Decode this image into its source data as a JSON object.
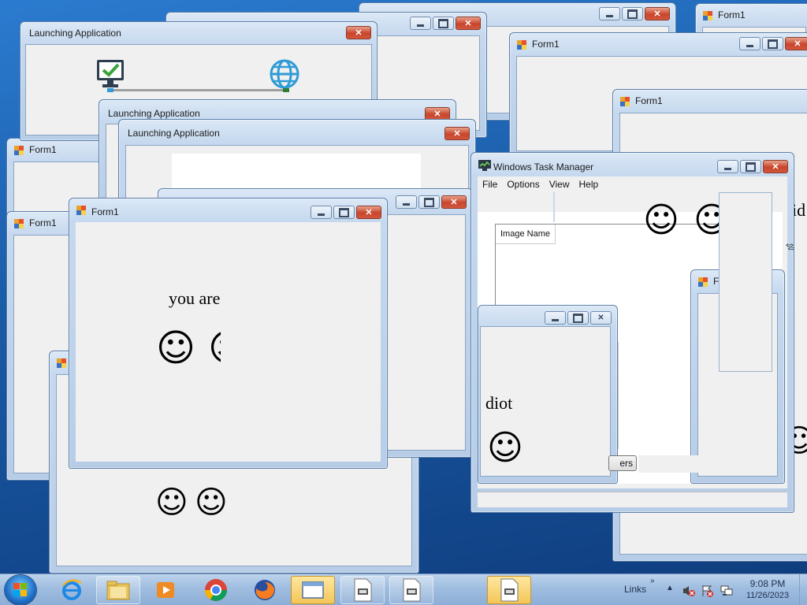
{
  "windows": {
    "launch1_title": "Launching Application",
    "launch2_title": "Launching Application",
    "launch3_title": "Launching Application",
    "form1_main_title": "Form1",
    "form1_right1_title": "Form1",
    "form1_right2_title": "Form1",
    "form1_right3_title": "Form1",
    "form1_left1_title": "Form1",
    "form1_left2_title": "Form1",
    "form1_mid_title": "Form1",
    "form1_inner_title": "Form1"
  },
  "form_main": {
    "message": "you are",
    "smiles": [
      "☺",
      "☺"
    ]
  },
  "fragments": {
    "idiot_text": "diot",
    "right_text": "id",
    "smile": "☺",
    "smile_partial": "☺"
  },
  "task_manager": {
    "title": "Windows Task Manager",
    "menu": [
      "File",
      "Options",
      "View",
      "Help"
    ],
    "column_header": "Image Name",
    "end_button_fragment": "ers"
  },
  "taskbar": {
    "links_label": "Links",
    "time": "9:08 PM",
    "date": "11/26/2023",
    "icons": [
      "internet-explorer-icon",
      "file-explorer-icon",
      "media-player-icon",
      "chrome-icon",
      "firefox-icon",
      "window-icon",
      "app-icon",
      "app-icon",
      "app-icon"
    ]
  },
  "colors": {
    "desktop": "#1a5aa5",
    "close_button": "#c8452b",
    "monitor_check": "#3aa33a",
    "globe": "#2f9bd6"
  }
}
